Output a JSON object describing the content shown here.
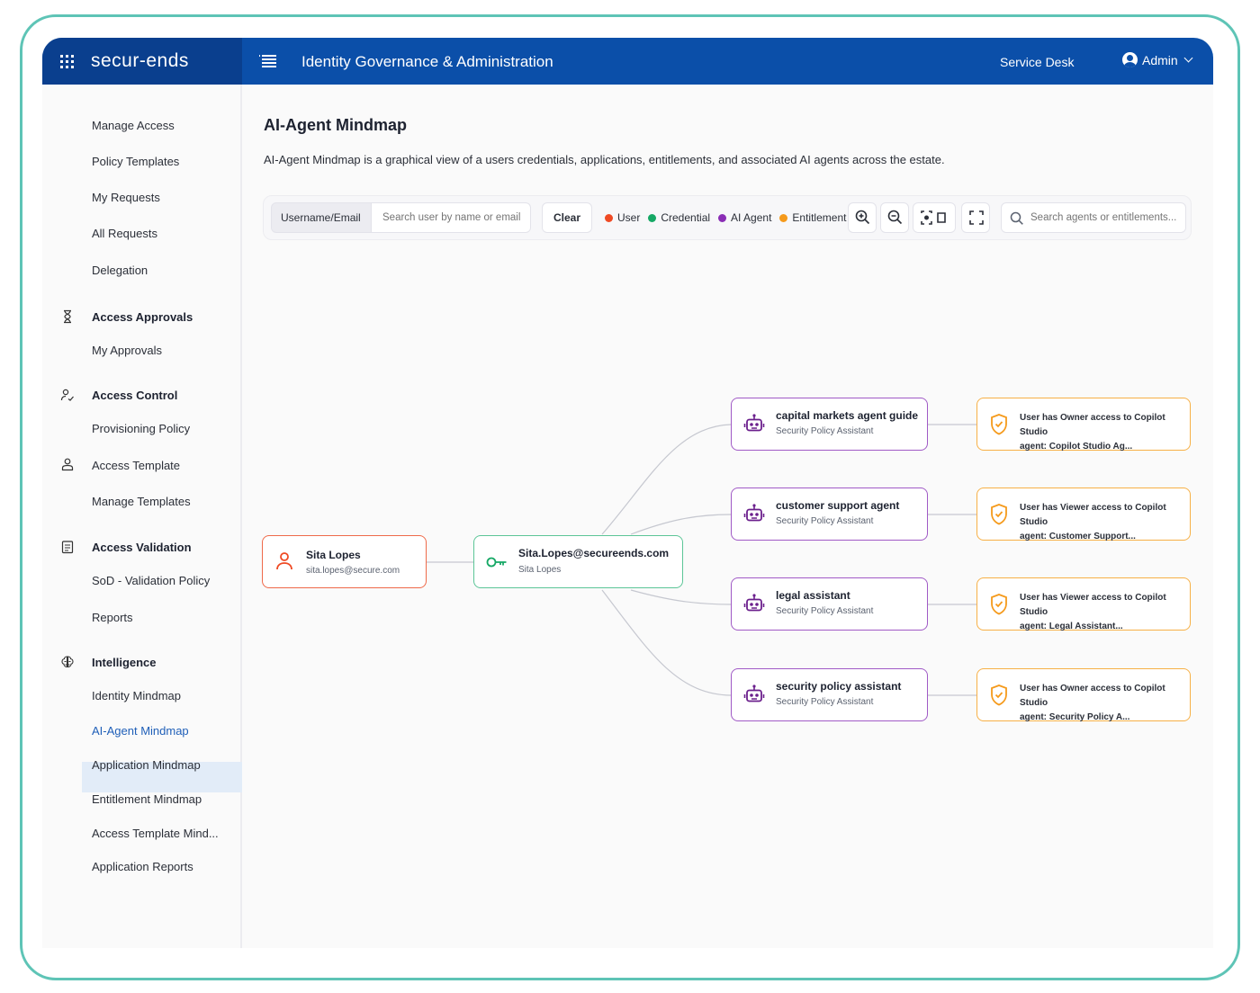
{
  "frame_color": "#5ec4b6",
  "topbar": {
    "brand": "secur-ends",
    "title": "Identity Governance & Administration",
    "service_desk": "Service Desk",
    "user": "Admin",
    "bg": "#0b4fa9"
  },
  "sidebar": {
    "items": [
      {
        "label": "Manage Access"
      },
      {
        "label": "Policy Templates"
      },
      {
        "label": "My Requests"
      },
      {
        "label": "All Requests"
      },
      {
        "label": "Delegation"
      }
    ],
    "approvals": {
      "heading": "Access Approvals",
      "icon": "hourglass-icon",
      "items": [
        "My Approvals"
      ]
    },
    "control": {
      "heading": "Access Control",
      "icon": "user-key-icon",
      "items": [
        "Provisioning Policy"
      ]
    },
    "template": {
      "heading": "Access Template",
      "icon": "user-icon",
      "items": [
        "Manage Templates"
      ]
    },
    "validation": {
      "heading": "Access Validation",
      "icon": "clipboard-icon",
      "items": [
        "SoD - Validation Policy",
        "Reports"
      ]
    },
    "intelligence": {
      "heading": "Intelligence",
      "icon": "brain-icon",
      "items": [
        "Identity Mindmap",
        "AI-Agent Mindmap",
        "Application Mindmap",
        "Entitlement Mindmap",
        "Access Template Mind...",
        "Application Reports"
      ],
      "active": "AI-Agent Mindmap"
    }
  },
  "main": {
    "title": "AI-Agent Mindmap",
    "description": "AI-Agent Mindmap is a graphical view of a users credentials, applications, entitlements, and associated AI agents across the estate."
  },
  "toolbar": {
    "field_label": "Username/Email",
    "search_placeholder": "Search user by name or email",
    "clear": "Clear",
    "legend": [
      {
        "label": "User",
        "color": "#ef4a24"
      },
      {
        "label": "Credential",
        "color": "#15a865"
      },
      {
        "label": "AI Agent",
        "color": "#8a2db5"
      },
      {
        "label": "Entitlement",
        "color": "#f59a1b"
      }
    ],
    "agent_search_placeholder": "Search agents or entitlements..."
  },
  "graph": {
    "user": {
      "name": "Sita Lopes",
      "email": "sita.lopes@secure.com",
      "color": "#ef6a4a"
    },
    "credential": {
      "id": "Sita.Lopes@secureends.com",
      "name": "Sita Lopes",
      "color": "#5cc597"
    },
    "agents": [
      {
        "name": "capital markets agent guide",
        "type": "Security Policy Assistant"
      },
      {
        "name": "customer support agent",
        "type": "Security Policy Assistant"
      },
      {
        "name": "legal assistant",
        "type": "Security Policy Assistant"
      },
      {
        "name": "security policy assistant",
        "type": "Security Policy Assistant"
      }
    ],
    "entitlements": [
      {
        "line1": "User has Owner access to Copilot Studio",
        "line2": "agent: Copilot Studio Ag..."
      },
      {
        "line1": "User has Viewer access to Copilot Studio",
        "line2": "agent: Customer Support..."
      },
      {
        "line1": "User has Viewer access to Copilot Studio",
        "line2": "agent: Legal Assistant..."
      },
      {
        "line1": "User has Owner access to Copilot Studio",
        "line2": "agent: Security Policy A..."
      }
    ],
    "agent_color": "#a05ac6",
    "entitlement_color": "#f7b046"
  }
}
